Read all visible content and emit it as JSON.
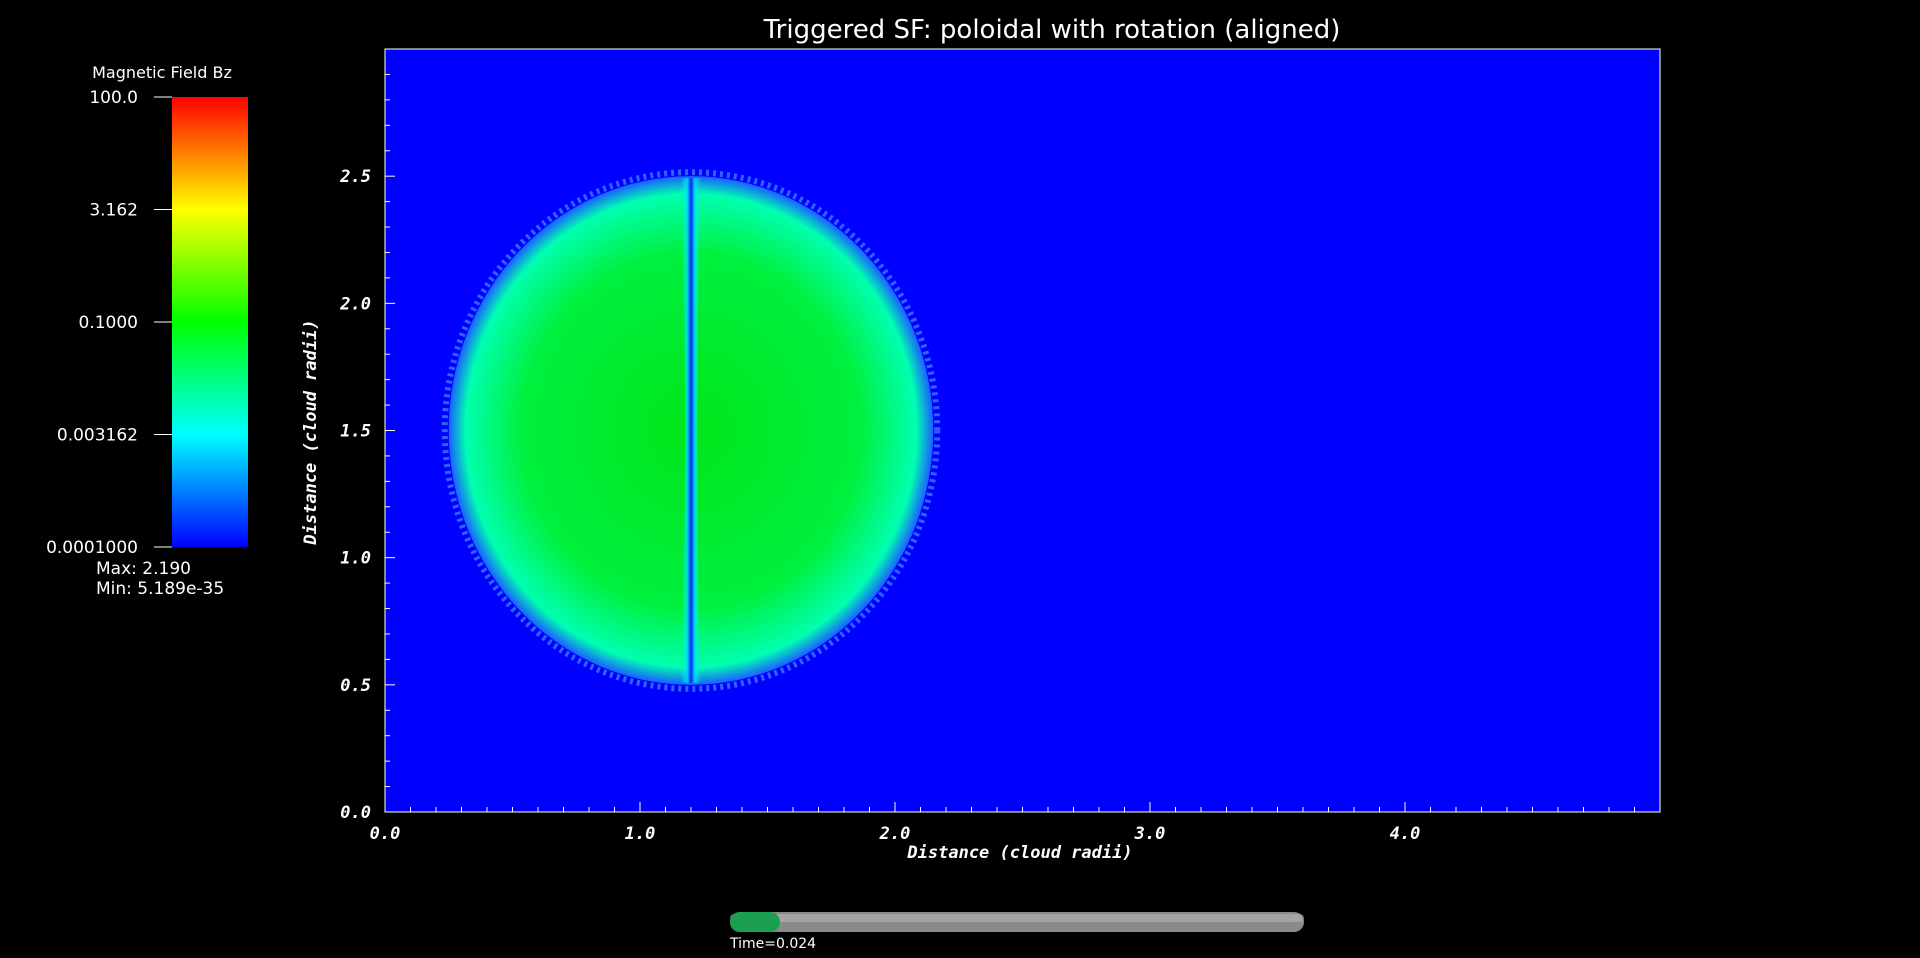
{
  "chart_data": {
    "type": "heatmap",
    "title": "Triggered SF: poloidal with rotation (aligned)",
    "xlabel": "Distance (cloud radii)",
    "ylabel": "Distance (cloud radii)",
    "xlim": [
      0.0,
      5.0
    ],
    "ylim": [
      0.0,
      3.0
    ],
    "x_ticks": [
      "0.0",
      "1.0",
      "2.0",
      "3.0",
      "4.0"
    ],
    "y_ticks": [
      "0.0",
      "0.5",
      "1.0",
      "1.5",
      "2.0",
      "2.5"
    ],
    "field": {
      "background_value": 0.0001,
      "cloud_center": [
        1.2,
        1.5
      ],
      "cloud_radius_x": 0.95,
      "cloud_radius_y": 1.0,
      "cloud_core_value": 0.1,
      "cloud_edge_value": 0.003162,
      "axis_channel_x": 1.2,
      "axis_channel_value": 0.0001
    },
    "colorbar": {
      "title": "Magnetic Field Bz",
      "scale": "log",
      "range": [
        0.0001,
        100.0
      ],
      "ticks": [
        "100.0",
        "3.162",
        "0.1000",
        "0.003162",
        "0.0001000"
      ],
      "max_label": "Max:  2.190",
      "min_label": "Min:  5.189e-35",
      "colors": [
        "#0000ff",
        "#00ffff",
        "#00ff00",
        "#ffff00",
        "#ff0000"
      ]
    },
    "time_slider": {
      "label": "Time=0.024",
      "progress": 0.087
    },
    "grid": false
  }
}
